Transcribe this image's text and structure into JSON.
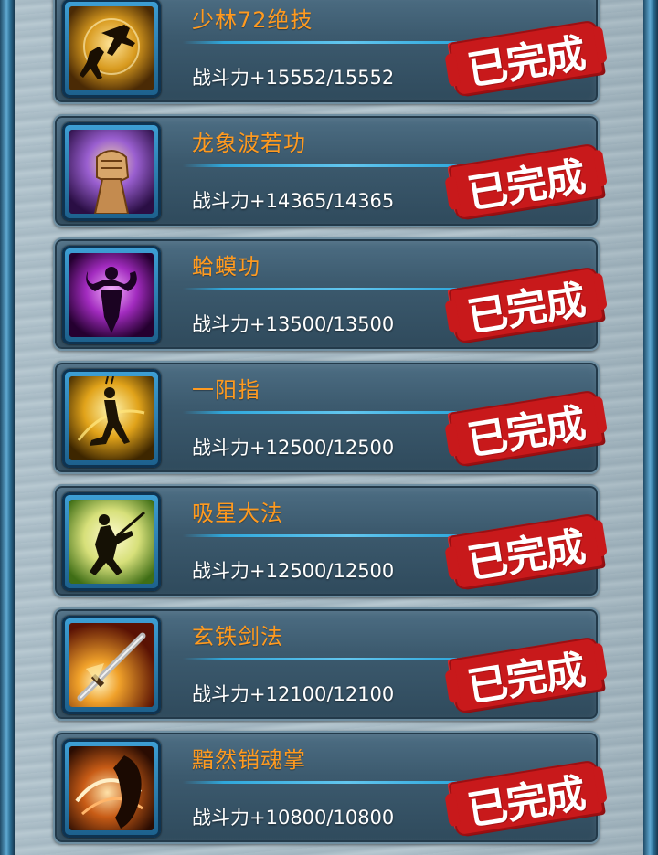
{
  "status_label": "已完成",
  "accent_colors": {
    "title": "#ff9a1f",
    "stat": "#ffffff",
    "stamp": "#c8191b",
    "frame": "#2a7fb4"
  },
  "skills": [
    {
      "name": "少林72绝技",
      "power": "战斗力+15552/15552",
      "icon": "kick-silhouette-icon"
    },
    {
      "name": "龙象波若功",
      "power": "战斗力+14365/14365",
      "icon": "fist-icon"
    },
    {
      "name": "蛤蟆功",
      "power": "战斗力+13500/13500",
      "icon": "flexing-figure-icon"
    },
    {
      "name": "一阳指",
      "power": "战斗力+12500/12500",
      "icon": "finger-pointing-figure-icon"
    },
    {
      "name": "吸星大法",
      "power": "战斗力+12500/12500",
      "icon": "sword-fighter-icon"
    },
    {
      "name": "玄铁剑法",
      "power": "战斗力+12100/12100",
      "icon": "sword-icon"
    },
    {
      "name": "黯然销魂掌",
      "power": "战斗力+10800/10800",
      "icon": "palm-swirl-icon"
    }
  ]
}
